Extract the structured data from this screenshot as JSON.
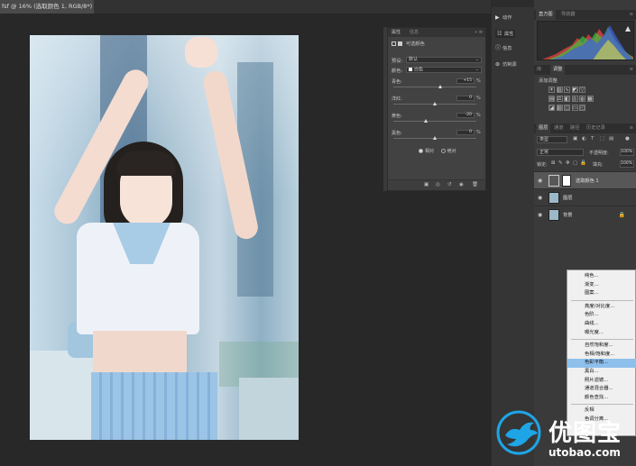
{
  "document": {
    "tab_title": "fsf @ 16% (选取颜色 1, RGB/8*) *",
    "tab_close": "×"
  },
  "properties_panel": {
    "tab_active": "属性",
    "tab_other": "信息",
    "controls": "« ≡",
    "adjustment_name": "可选颜色",
    "preset_label": "预设:",
    "preset_value": "默认",
    "colors_label": "颜色:",
    "colors_value": "白色",
    "sliders": [
      {
        "label": "青色:",
        "value": "+15",
        "pos": 0.57
      },
      {
        "label": "洋红:",
        "value": "0",
        "pos": 0.5
      },
      {
        "label": "黄色:",
        "value": "-20",
        "pos": 0.4
      },
      {
        "label": "黑色:",
        "value": "0",
        "pos": 0.5
      }
    ],
    "percent": "%",
    "radio_relative": "相对",
    "radio_absolute": "绝对",
    "radio_selected": "relative"
  },
  "side_strip": {
    "items": [
      "动作",
      "属性",
      "信息",
      "仿制源"
    ]
  },
  "right_dock": {
    "histogram_tabs": [
      "直方图",
      "导航器"
    ],
    "adjust_tabs": [
      "库",
      "调整"
    ],
    "adjust_title": "添加调整",
    "layer_tabs": [
      "图层",
      "通道",
      "路径",
      "历史记录"
    ],
    "filter_kind": "类型",
    "blend_mode": "正常",
    "opacity_label": "不透明度:",
    "opacity_value": "100%",
    "lock_label": "锁定:",
    "fill_label": "填充:",
    "fill_value": "100%",
    "layers": [
      {
        "name": "选取颜色 1",
        "type": "adjustment",
        "selected": true
      },
      {
        "name": "图层",
        "type": "image",
        "selected": false
      },
      {
        "name": "背景",
        "type": "image",
        "selected": false,
        "locked": true
      }
    ]
  },
  "context_menu": {
    "items": [
      {
        "label": "纯色...",
        "sep_before": false
      },
      {
        "label": "渐变...",
        "sep_before": false
      },
      {
        "label": "图案...",
        "sep_before": false
      },
      {
        "label": "亮度/对比度...",
        "sep_before": true
      },
      {
        "label": "色阶...",
        "sep_before": false
      },
      {
        "label": "曲线...",
        "sep_before": false
      },
      {
        "label": "曝光度...",
        "sep_before": false
      },
      {
        "label": "自然饱和度...",
        "sep_before": true
      },
      {
        "label": "色相/饱和度...",
        "sep_before": false
      },
      {
        "label": "色彩平衡...",
        "sep_before": false,
        "highlight": true
      },
      {
        "label": "黑白...",
        "sep_before": false
      },
      {
        "label": "照片滤镜...",
        "sep_before": false
      },
      {
        "label": "通道混合器...",
        "sep_before": false
      },
      {
        "label": "颜色查找...",
        "sep_before": false
      },
      {
        "label": "反相",
        "sep_before": true
      },
      {
        "label": "色调分离...",
        "sep_before": false
      }
    ]
  },
  "watermark": {
    "brand": "优图宝",
    "url": "utobao.com",
    "brand_color": "#1ea5e6"
  }
}
